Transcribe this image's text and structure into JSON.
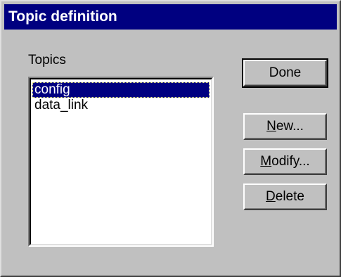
{
  "window": {
    "title": "Topic definition"
  },
  "topics": {
    "label": "Topics",
    "items": [
      {
        "label": "config",
        "selected": true
      },
      {
        "label": "data_link",
        "selected": false
      }
    ]
  },
  "buttons": {
    "done": {
      "label": "Done"
    },
    "new": {
      "mnemonic": "N",
      "rest": "ew..."
    },
    "modify": {
      "mnemonic": "M",
      "rest": "odify..."
    },
    "delete": {
      "mnemonic": "D",
      "rest": "elete"
    }
  },
  "colors": {
    "titlebar": "#000080",
    "dialog_bg": "#c0c0c0",
    "selection": "#000080"
  }
}
